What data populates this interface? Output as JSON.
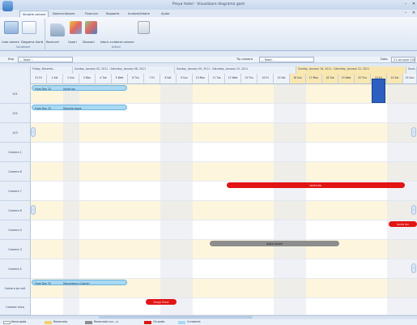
{
  "window": {
    "title": "Preya Hotel - Vizualizare diagrama gant",
    "min": "–",
    "close": "✕",
    "sub_min": "–",
    "sub_close": "✕"
  },
  "tabs": [
    "Situatie camere",
    "Nomenclatoare",
    "Financiar",
    "Rapoarte",
    "Analize/Setaire",
    "Ajutor"
  ],
  "ribbon": {
    "buttons": [
      "Lista camere",
      "Diagrama Gantt",
      "Rezervari",
      "Cazari",
      "Decazari",
      "Istoric curatenie camera"
    ],
    "groups": [
      "Vizualizare",
      "Actiuni"
    ]
  },
  "filters": {
    "etaj_label": "Etaj",
    "etaj_value": "-- Toate --",
    "tip_label": "Tip camera",
    "tip_value": "-- Toate --",
    "data_label": "Data",
    "data_value": "21 ianuarie 2011"
  },
  "weeks": [
    "Friday, Decemb...",
    "Sunday, January 02, 2011 - Saturday, January 08, 2011",
    "Sunday, January 09, 2011 - Saturday, January 15, 2011",
    "Sunday, January 16, 2011 - Saturday, January 22, 2011",
    "Sund..."
  ],
  "days": [
    "31 Fri",
    "1 Sat",
    "2 Sun",
    "3 Mon",
    "4 Tue",
    "5 Wed",
    "6 Thu",
    "7 Fri",
    "8 Sat",
    "9 Sun",
    "10 Mon",
    "11 Tue",
    "12 Wed",
    "13 Thu",
    "14 Fri",
    "15 Sat",
    "16 Sun",
    "17 Mon",
    "18 Tue",
    "19 Wed",
    "20 Thu",
    "21 Fri",
    "22 Sat",
    "23 Sun"
  ],
  "rooms": [
    "101",
    "102",
    "103",
    "Camera 1",
    "Camera 6",
    "Camera 7",
    "Camera 8",
    "Camera 4",
    "Camera 3",
    "Camera 5",
    "Camera pe colt",
    "Camera mica"
  ],
  "bookings": {
    "b1_from": "From Dec 22",
    "b1_name": "Ionita Ion",
    "b2_from": "From Dec 22",
    "b2_name": "Marcela Ioana",
    "b3_name": "Ionita Ion",
    "b4_name": "Aldea Andrei",
    "b5_name": "Ionita Ion",
    "b6_from": "From Dec 22",
    "b6_name": "Mocanesscu Cosmin",
    "b7_name": "Draga Elisei"
  },
  "legend": [
    "Neocupata",
    "Rezervata",
    "Rezervata nuc...a",
    "Ocupata",
    "Curatenie"
  ],
  "colors": {
    "reserved": "#a9d9f3",
    "occupied": "#e21414",
    "gray": "#8d8d8d",
    "highlight": "#f9e7b2"
  }
}
